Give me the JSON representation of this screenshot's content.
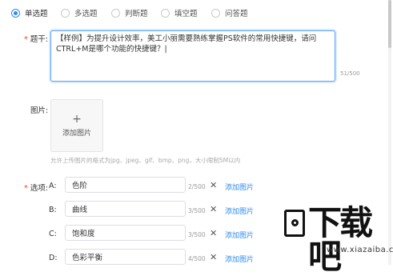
{
  "question_types": [
    {
      "label": "单选题",
      "checked": true
    },
    {
      "label": "多选题",
      "checked": false
    },
    {
      "label": "判断题",
      "checked": false
    },
    {
      "label": "填空题",
      "checked": false
    },
    {
      "label": "问答题",
      "checked": false
    }
  ],
  "stem": {
    "required_mark": "*",
    "label": "题干:",
    "text": "【样例】为提升设计效率，美工小丽需要熟练掌握PS软件的常用快捷键，请问CTRL+M是哪个功能的快捷键？|",
    "counter": "51/500"
  },
  "image": {
    "label": "图片:",
    "plus": "+",
    "add_label": "添加图片",
    "hint": "允许上传图片的格式为jpg、jpeg、gif、bmp、png，大小限制5M以内"
  },
  "options": {
    "required_mark": "*",
    "label": "选项:",
    "items": [
      {
        "letter": "A:",
        "value": "色阶",
        "count": "2/500",
        "delete": "✕",
        "add_image": "添加图片"
      },
      {
        "letter": "B:",
        "value": "曲线",
        "count": "3/500",
        "delete": "✕",
        "add_image": "添加图片"
      },
      {
        "letter": "C:",
        "value": "饱和度",
        "count": "3/500",
        "delete": "✕",
        "add_image": "添加图片"
      },
      {
        "letter": "D:",
        "value": "色彩平衡",
        "count": "4/500",
        "delete": "✕",
        "add_image": "添加图片"
      }
    ]
  },
  "watermark": {
    "text": "下载吧",
    "url": "www.xiazaiba.com"
  },
  "colors": {
    "accent": "#2d8cf0",
    "required": "#ed4014"
  }
}
